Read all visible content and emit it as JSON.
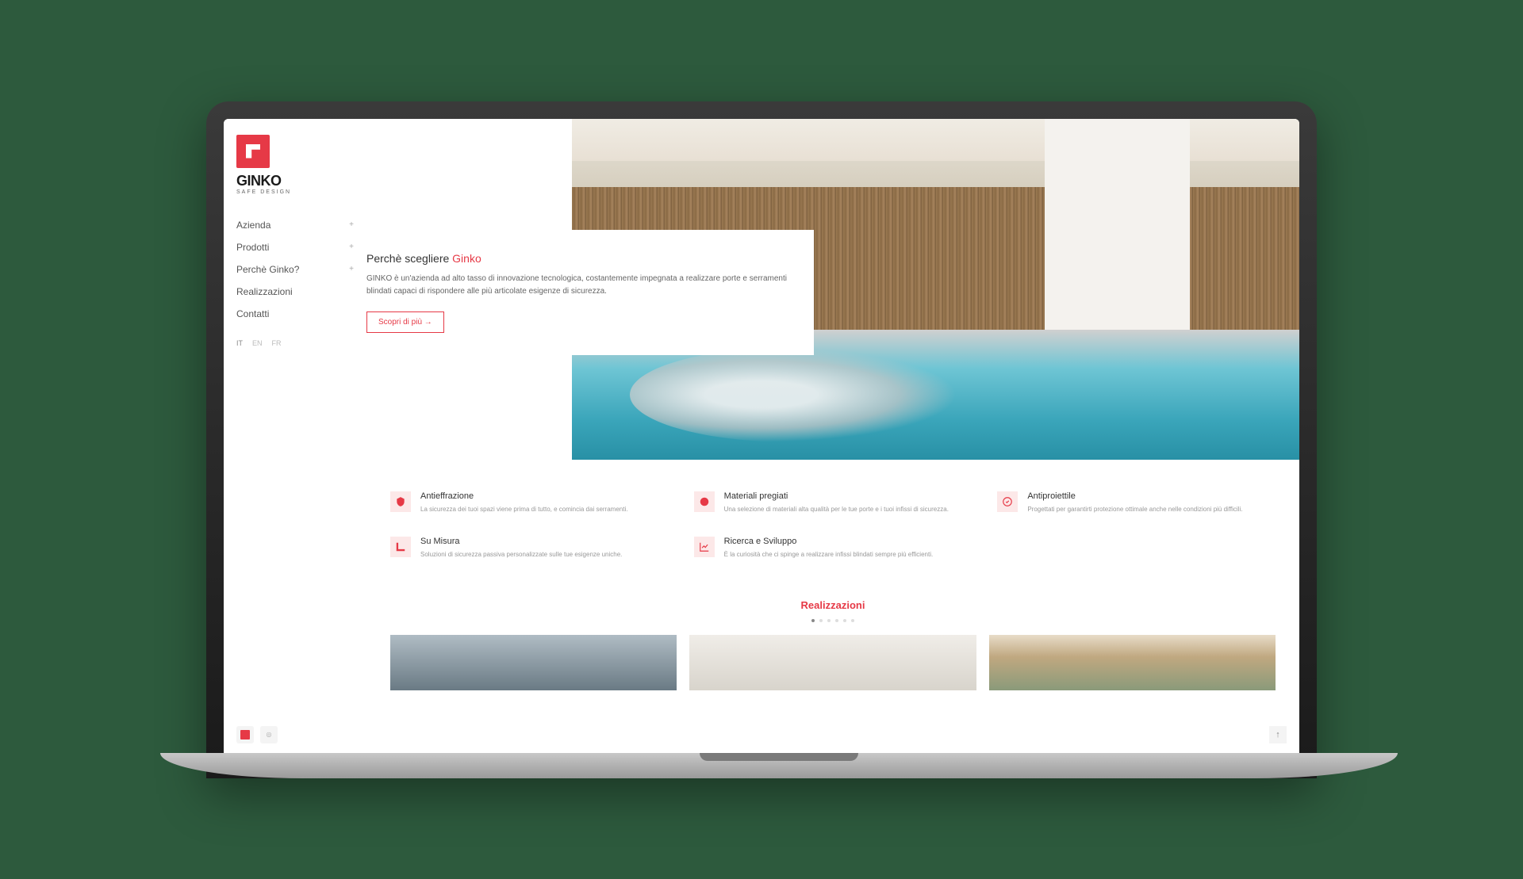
{
  "brand": {
    "name": "GINKO",
    "tagline": "SAFE DESIGN"
  },
  "nav": {
    "items": [
      {
        "label": "Azienda",
        "expandable": true
      },
      {
        "label": "Prodotti",
        "expandable": true
      },
      {
        "label": "Perchè Ginko?",
        "expandable": true
      },
      {
        "label": "Realizzazioni",
        "expandable": false
      },
      {
        "label": "Contatti",
        "expandable": false
      }
    ]
  },
  "languages": [
    "IT",
    "EN",
    "FR"
  ],
  "hero": {
    "title_prefix": "Perchè scegliere ",
    "title_accent": "Ginko",
    "body": "GINKO è un'azienda ad alto tasso di innovazione tecnologica, costantemente impegnata a realizzare porte e serramenti blindati capaci di rispondere alle più articolate esigenze di sicurezza.",
    "cta": "Scopri di più →"
  },
  "features": [
    {
      "icon": "shield",
      "title": "Antieffrazione",
      "desc": "La sicurezza dei tuoi spazi viene prima di tutto, e comincia dai serramenti."
    },
    {
      "icon": "badge",
      "title": "Materiali pregiati",
      "desc": "Una selezione di materiali alta qualità per le tue porte e i tuoi infissi di sicurezza."
    },
    {
      "icon": "target",
      "title": "Antiproiettile",
      "desc": "Progettati per garantirti protezione ottimale anche nelle condizioni più difficili."
    },
    {
      "icon": "ruler",
      "title": "Su Misura",
      "desc": "Soluzioni di sicurezza passiva personalizzate sulle tue esigenze uniche."
    },
    {
      "icon": "chart",
      "title": "Ricerca e Sviluppo",
      "desc": "È la curiosità che ci spinge a realizzare infissi blindati sempre più efficienti."
    }
  ],
  "realizzazioni": {
    "title": "Realizzazioni",
    "dot_count": 6,
    "active_dot": 0
  },
  "colors": {
    "accent": "#e63946"
  }
}
